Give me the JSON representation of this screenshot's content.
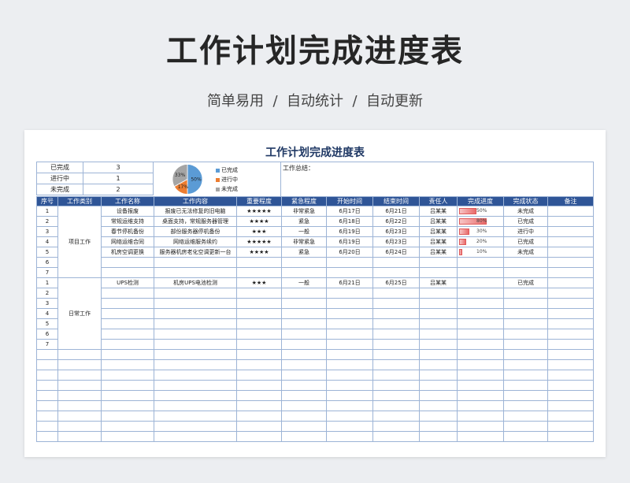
{
  "banner": {
    "title": "工作计划完成进度表",
    "subtitle": "简单易用  /  自动统计  /  自动更新"
  },
  "sheet": {
    "title": "工作计划完成进度表",
    "summary": [
      {
        "label": "已完成",
        "value": "3"
      },
      {
        "label": "进行中",
        "value": "1"
      },
      {
        "label": "未完成",
        "value": "2"
      }
    ],
    "notes_label": "工作总结：",
    "pie": {
      "slices": [
        {
          "name": "已完成",
          "percent": 50,
          "label": "50%",
          "color": "#5b9bd5"
        },
        {
          "name": "进行中",
          "percent": 17,
          "label": "17%",
          "color": "#ed7d31"
        },
        {
          "name": "未完成",
          "percent": 33,
          "label": "33%",
          "color": "#a5a5a5"
        }
      ]
    },
    "headers": [
      "序号",
      "工作类别",
      "工作名称",
      "工作内容",
      "重要程度",
      "紧急程度",
      "开始时间",
      "结束时间",
      "责任人",
      "完成进度",
      "完成状态",
      "备注"
    ],
    "project_category": "项目工作",
    "daily_category": "日常工作",
    "project_rows": [
      {
        "no": "1",
        "name": "设备报废",
        "content": "报废已无法修复的旧电脑",
        "stars": "★★★★★",
        "urgency": "非常紧急",
        "start": "6月17日",
        "end": "6月21日",
        "owner": "吕某某",
        "progress": 50,
        "progress_label": "50%",
        "status": "未完成"
      },
      {
        "no": "2",
        "name": "常规运维支持",
        "content": "桌面支持，常规服务器管理",
        "stars": "★★★★",
        "urgency": "紧急",
        "start": "6月18日",
        "end": "6月22日",
        "owner": "吕某某",
        "progress": 80,
        "progress_label": "80%",
        "status": "已完成"
      },
      {
        "no": "3",
        "name": "春节停机备份",
        "content": "部份服务器停机备份",
        "stars": "★★★",
        "urgency": "一般",
        "start": "6月19日",
        "end": "6月23日",
        "owner": "吕某某",
        "progress": 30,
        "progress_label": "30%",
        "status": "进行中"
      },
      {
        "no": "4",
        "name": "网络运维合同",
        "content": "网络运维服务续约",
        "stars": "★★★★★",
        "urgency": "非常紧急",
        "start": "6月19日",
        "end": "6月23日",
        "owner": "吕某某",
        "progress": 20,
        "progress_label": "20%",
        "status": "已完成"
      },
      {
        "no": "5",
        "name": "机房空调更换",
        "content": "服务器机房老化空调更新一台",
        "stars": "★★★★",
        "urgency": "紧急",
        "start": "6月20日",
        "end": "6月24日",
        "owner": "吕某某",
        "progress": 10,
        "progress_label": "10%",
        "status": "未完成"
      },
      {
        "no": "6"
      },
      {
        "no": "7"
      }
    ],
    "daily_rows": [
      {
        "no": "1",
        "name": "UPS检测",
        "content": "机房UPS电池检测",
        "stars": "★★★",
        "urgency": "一般",
        "start": "6月21日",
        "end": "6月25日",
        "owner": "吕某某",
        "status": "已完成"
      },
      {
        "no": "2"
      },
      {
        "no": "3"
      },
      {
        "no": "4"
      },
      {
        "no": "5"
      },
      {
        "no": "6"
      },
      {
        "no": "7"
      }
    ],
    "blank_rows": 9
  }
}
